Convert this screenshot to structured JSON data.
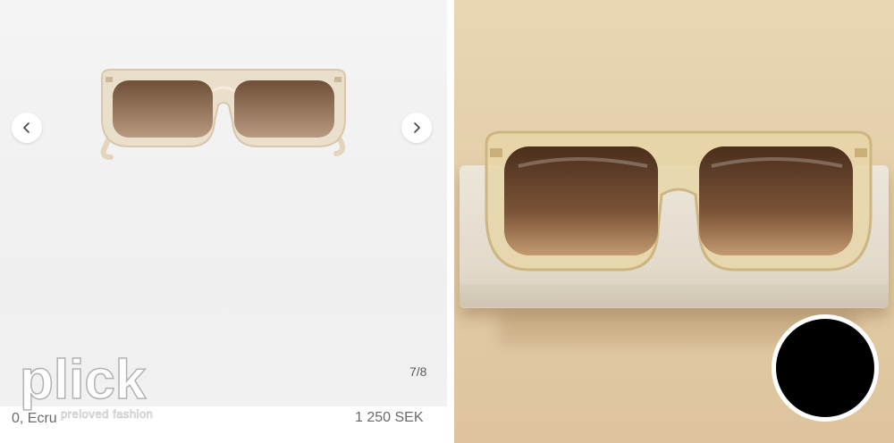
{
  "listing": {
    "image_counter": "7/8",
    "title": "0, Ecru",
    "price": "1 250 SEK"
  },
  "brand": {
    "logo_text": "plick",
    "tagline": "preloved fashion"
  },
  "icons": {
    "prev": "chevron-left-icon",
    "next": "chevron-right-icon"
  },
  "colors": {
    "frame_tint": "#e9dcc4",
    "lens_tint": "#7a5a3e",
    "warm_background": "#e6d2ae"
  }
}
